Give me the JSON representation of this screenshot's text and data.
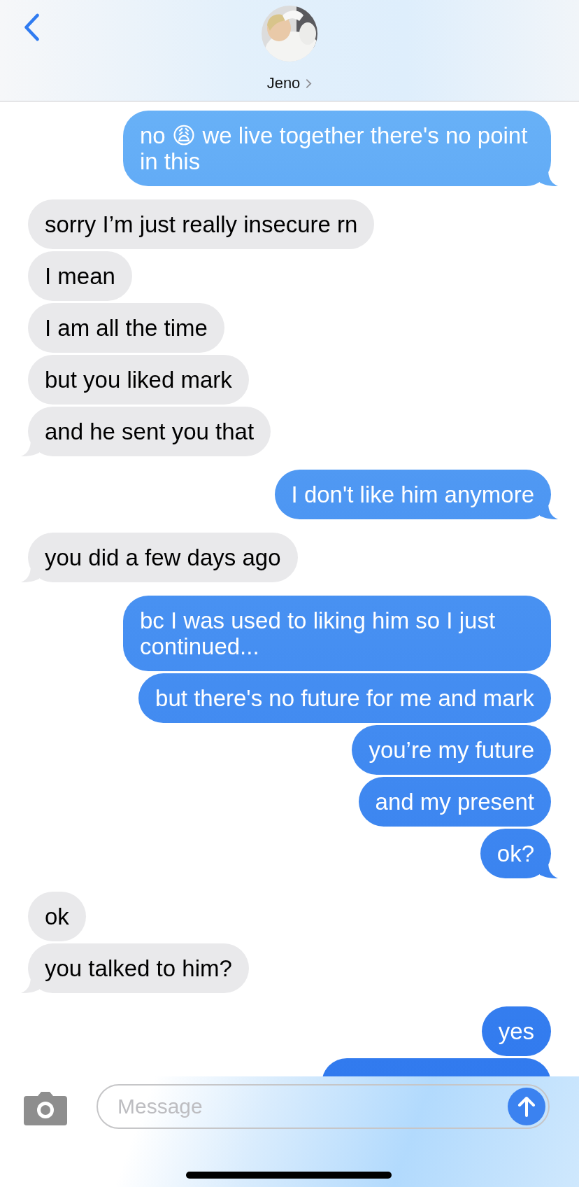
{
  "header": {
    "contact_name": "Jeno"
  },
  "messages": [
    {
      "outgoing": true,
      "text": "no 😩 we live together there's no point in this",
      "tail": true
    },
    {
      "outgoing": false,
      "text": "sorry I’m just really insecure rn",
      "tail": false
    },
    {
      "outgoing": false,
      "text": "I mean",
      "tail": false
    },
    {
      "outgoing": false,
      "text": "I am all the time",
      "tail": false
    },
    {
      "outgoing": false,
      "text": "but you liked mark",
      "tail": false
    },
    {
      "outgoing": false,
      "text": "and he sent you that",
      "tail": true
    },
    {
      "outgoing": true,
      "text": "I don't like him anymore",
      "tail": true
    },
    {
      "outgoing": false,
      "text": "you did a few days ago",
      "tail": true
    },
    {
      "outgoing": true,
      "text": "bc I was used to liking him so I just continued...",
      "tail": false
    },
    {
      "outgoing": true,
      "text": "but there's no future for me and mark",
      "tail": false
    },
    {
      "outgoing": true,
      "text": "you’re my future",
      "tail": false
    },
    {
      "outgoing": true,
      "text": "and my present",
      "tail": false
    },
    {
      "outgoing": true,
      "text": "ok?",
      "tail": true
    },
    {
      "outgoing": false,
      "text": "ok",
      "tail": false
    },
    {
      "outgoing": false,
      "text": "you talked to him?",
      "tail": true
    },
    {
      "outgoing": true,
      "text": "yes",
      "tail": false
    },
    {
      "outgoing": true,
      "kind": "cut_off"
    }
  ],
  "composer": {
    "placeholder": "Message"
  }
}
